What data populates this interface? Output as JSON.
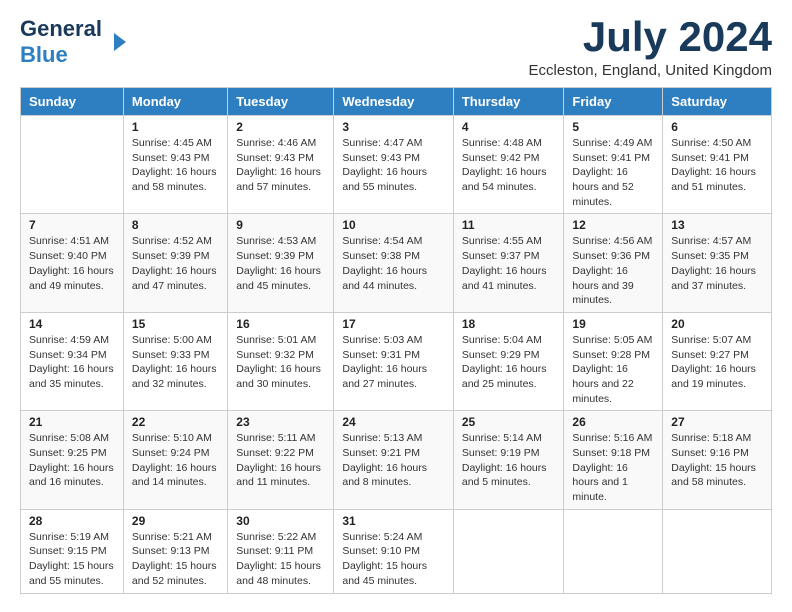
{
  "header": {
    "logo_general": "General",
    "logo_blue": "Blue",
    "main_title": "July 2024",
    "subtitle": "Eccleston, England, United Kingdom"
  },
  "days_of_week": [
    "Sunday",
    "Monday",
    "Tuesday",
    "Wednesday",
    "Thursday",
    "Friday",
    "Saturday"
  ],
  "weeks": [
    [
      {
        "day": "",
        "sunrise": "",
        "sunset": "",
        "daylight": ""
      },
      {
        "day": "1",
        "sunrise": "Sunrise: 4:45 AM",
        "sunset": "Sunset: 9:43 PM",
        "daylight": "Daylight: 16 hours and 58 minutes."
      },
      {
        "day": "2",
        "sunrise": "Sunrise: 4:46 AM",
        "sunset": "Sunset: 9:43 PM",
        "daylight": "Daylight: 16 hours and 57 minutes."
      },
      {
        "day": "3",
        "sunrise": "Sunrise: 4:47 AM",
        "sunset": "Sunset: 9:43 PM",
        "daylight": "Daylight: 16 hours and 55 minutes."
      },
      {
        "day": "4",
        "sunrise": "Sunrise: 4:48 AM",
        "sunset": "Sunset: 9:42 PM",
        "daylight": "Daylight: 16 hours and 54 minutes."
      },
      {
        "day": "5",
        "sunrise": "Sunrise: 4:49 AM",
        "sunset": "Sunset: 9:41 PM",
        "daylight": "Daylight: 16 hours and 52 minutes."
      },
      {
        "day": "6",
        "sunrise": "Sunrise: 4:50 AM",
        "sunset": "Sunset: 9:41 PM",
        "daylight": "Daylight: 16 hours and 51 minutes."
      }
    ],
    [
      {
        "day": "7",
        "sunrise": "Sunrise: 4:51 AM",
        "sunset": "Sunset: 9:40 PM",
        "daylight": "Daylight: 16 hours and 49 minutes."
      },
      {
        "day": "8",
        "sunrise": "Sunrise: 4:52 AM",
        "sunset": "Sunset: 9:39 PM",
        "daylight": "Daylight: 16 hours and 47 minutes."
      },
      {
        "day": "9",
        "sunrise": "Sunrise: 4:53 AM",
        "sunset": "Sunset: 9:39 PM",
        "daylight": "Daylight: 16 hours and 45 minutes."
      },
      {
        "day": "10",
        "sunrise": "Sunrise: 4:54 AM",
        "sunset": "Sunset: 9:38 PM",
        "daylight": "Daylight: 16 hours and 44 minutes."
      },
      {
        "day": "11",
        "sunrise": "Sunrise: 4:55 AM",
        "sunset": "Sunset: 9:37 PM",
        "daylight": "Daylight: 16 hours and 41 minutes."
      },
      {
        "day": "12",
        "sunrise": "Sunrise: 4:56 AM",
        "sunset": "Sunset: 9:36 PM",
        "daylight": "Daylight: 16 hours and 39 minutes."
      },
      {
        "day": "13",
        "sunrise": "Sunrise: 4:57 AM",
        "sunset": "Sunset: 9:35 PM",
        "daylight": "Daylight: 16 hours and 37 minutes."
      }
    ],
    [
      {
        "day": "14",
        "sunrise": "Sunrise: 4:59 AM",
        "sunset": "Sunset: 9:34 PM",
        "daylight": "Daylight: 16 hours and 35 minutes."
      },
      {
        "day": "15",
        "sunrise": "Sunrise: 5:00 AM",
        "sunset": "Sunset: 9:33 PM",
        "daylight": "Daylight: 16 hours and 32 minutes."
      },
      {
        "day": "16",
        "sunrise": "Sunrise: 5:01 AM",
        "sunset": "Sunset: 9:32 PM",
        "daylight": "Daylight: 16 hours and 30 minutes."
      },
      {
        "day": "17",
        "sunrise": "Sunrise: 5:03 AM",
        "sunset": "Sunset: 9:31 PM",
        "daylight": "Daylight: 16 hours and 27 minutes."
      },
      {
        "day": "18",
        "sunrise": "Sunrise: 5:04 AM",
        "sunset": "Sunset: 9:29 PM",
        "daylight": "Daylight: 16 hours and 25 minutes."
      },
      {
        "day": "19",
        "sunrise": "Sunrise: 5:05 AM",
        "sunset": "Sunset: 9:28 PM",
        "daylight": "Daylight: 16 hours and 22 minutes."
      },
      {
        "day": "20",
        "sunrise": "Sunrise: 5:07 AM",
        "sunset": "Sunset: 9:27 PM",
        "daylight": "Daylight: 16 hours and 19 minutes."
      }
    ],
    [
      {
        "day": "21",
        "sunrise": "Sunrise: 5:08 AM",
        "sunset": "Sunset: 9:25 PM",
        "daylight": "Daylight: 16 hours and 16 minutes."
      },
      {
        "day": "22",
        "sunrise": "Sunrise: 5:10 AM",
        "sunset": "Sunset: 9:24 PM",
        "daylight": "Daylight: 16 hours and 14 minutes."
      },
      {
        "day": "23",
        "sunrise": "Sunrise: 5:11 AM",
        "sunset": "Sunset: 9:22 PM",
        "daylight": "Daylight: 16 hours and 11 minutes."
      },
      {
        "day": "24",
        "sunrise": "Sunrise: 5:13 AM",
        "sunset": "Sunset: 9:21 PM",
        "daylight": "Daylight: 16 hours and 8 minutes."
      },
      {
        "day": "25",
        "sunrise": "Sunrise: 5:14 AM",
        "sunset": "Sunset: 9:19 PM",
        "daylight": "Daylight: 16 hours and 5 minutes."
      },
      {
        "day": "26",
        "sunrise": "Sunrise: 5:16 AM",
        "sunset": "Sunset: 9:18 PM",
        "daylight": "Daylight: 16 hours and 1 minute."
      },
      {
        "day": "27",
        "sunrise": "Sunrise: 5:18 AM",
        "sunset": "Sunset: 9:16 PM",
        "daylight": "Daylight: 15 hours and 58 minutes."
      }
    ],
    [
      {
        "day": "28",
        "sunrise": "Sunrise: 5:19 AM",
        "sunset": "Sunset: 9:15 PM",
        "daylight": "Daylight: 15 hours and 55 minutes."
      },
      {
        "day": "29",
        "sunrise": "Sunrise: 5:21 AM",
        "sunset": "Sunset: 9:13 PM",
        "daylight": "Daylight: 15 hours and 52 minutes."
      },
      {
        "day": "30",
        "sunrise": "Sunrise: 5:22 AM",
        "sunset": "Sunset: 9:11 PM",
        "daylight": "Daylight: 15 hours and 48 minutes."
      },
      {
        "day": "31",
        "sunrise": "Sunrise: 5:24 AM",
        "sunset": "Sunset: 9:10 PM",
        "daylight": "Daylight: 15 hours and 45 minutes."
      },
      {
        "day": "",
        "sunrise": "",
        "sunset": "",
        "daylight": ""
      },
      {
        "day": "",
        "sunrise": "",
        "sunset": "",
        "daylight": ""
      },
      {
        "day": "",
        "sunrise": "",
        "sunset": "",
        "daylight": ""
      }
    ]
  ]
}
